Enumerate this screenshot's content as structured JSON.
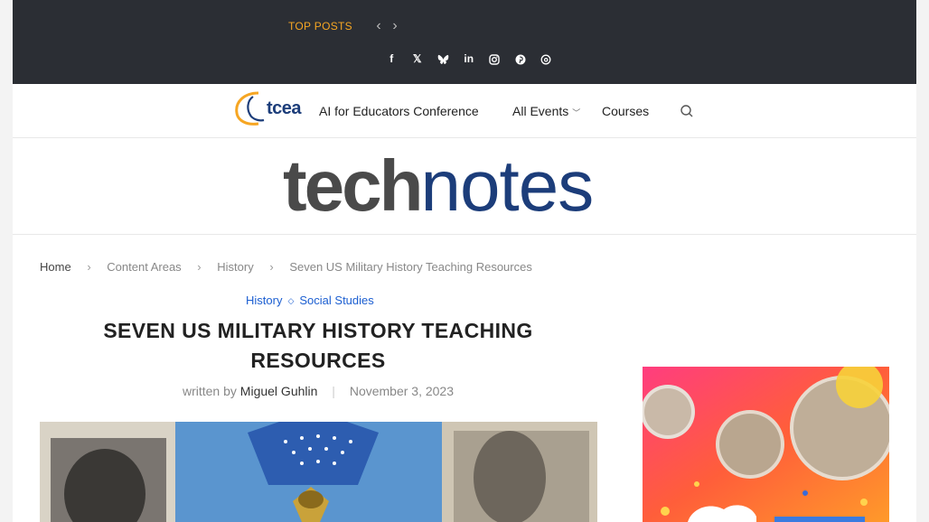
{
  "topbar": {
    "top_posts_label": "TOP POSTS",
    "prev_arrow": "‹",
    "next_arrow": "›",
    "social": [
      {
        "icon": "facebook-icon",
        "glyph": "f"
      },
      {
        "icon": "x-icon",
        "glyph": "𝕏"
      },
      {
        "icon": "bluesky-icon",
        "glyph": "🦋"
      },
      {
        "icon": "linkedin-icon",
        "glyph": "in"
      },
      {
        "icon": "instagram-icon",
        "glyph": "◎"
      },
      {
        "icon": "pinterest-icon",
        "glyph": "℗"
      },
      {
        "icon": "threads-icon",
        "glyph": "@"
      }
    ]
  },
  "nav": {
    "logo_text": "tcea",
    "items": [
      {
        "label": "AI for Educators Conference"
      },
      {
        "label": "All Events"
      },
      {
        "label": "Courses"
      }
    ]
  },
  "masthead": {
    "brand_part1": "tech",
    "brand_part2": "notes"
  },
  "breadcrumb": {
    "items": [
      "Home",
      "Content Areas",
      "History",
      "Seven US Military History Teaching Resources"
    ]
  },
  "article": {
    "categories": [
      "History",
      "Social Studies"
    ],
    "title_line1": "SEVEN US MILITARY HISTORY TEACHING",
    "title_line2": "RESOURCES",
    "written_by": "written by",
    "author": "Miguel Guhlin",
    "date": "November 3, 2023"
  },
  "colors": {
    "topbar_bg": "#2b2e34",
    "accent_orange": "#f6a623",
    "brand_blue": "#1c3d7a",
    "link_blue": "#1c5fd1"
  }
}
